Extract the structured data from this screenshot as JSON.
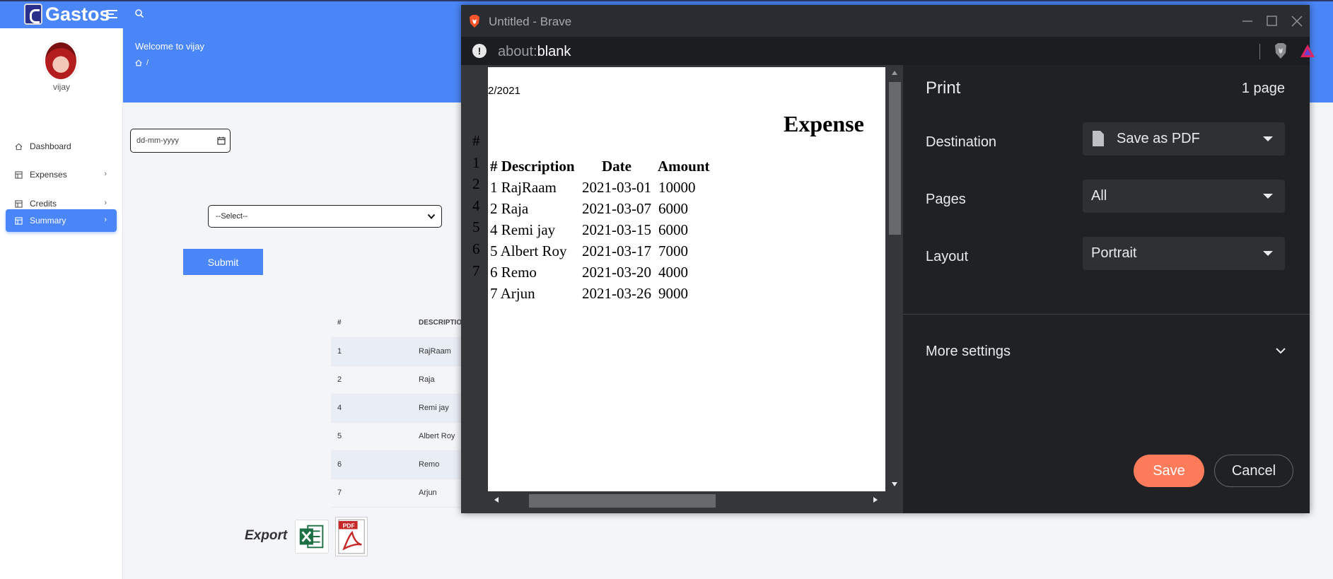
{
  "app": {
    "name": "Gastos"
  },
  "sidebar": {
    "user_name": "vijay",
    "items": [
      {
        "label": "Dashboard",
        "icon": "home-icon"
      },
      {
        "label": "Expenses",
        "icon": "table-icon"
      },
      {
        "label": "Credits",
        "icon": "table-icon"
      },
      {
        "label": "Summary",
        "icon": "table-icon",
        "active": true
      }
    ]
  },
  "header": {
    "welcome": "Welcome to vijay",
    "breadcrumb_sep": "/"
  },
  "form": {
    "date_placeholder": "dd-mm-yyyy",
    "select_value": "--Select--",
    "submit_label": "Submit"
  },
  "table": {
    "headers": [
      "#",
      "DESCRIPTION"
    ],
    "rows": [
      {
        "id": "1",
        "description": "RajRaam"
      },
      {
        "id": "2",
        "description": "Raja"
      },
      {
        "id": "4",
        "description": "Remi jay"
      },
      {
        "id": "5",
        "description": "Albert Roy"
      },
      {
        "id": "6",
        "description": "Remo"
      },
      {
        "id": "7",
        "description": "Arjun"
      }
    ]
  },
  "export": {
    "label": "Export"
  },
  "browser": {
    "title": "Untitled - Brave",
    "url_scheme": "about:",
    "url_path": "blank",
    "preview": {
      "date_fragment": "2/2021",
      "title": "Expense",
      "underlay_head": "#",
      "underlay_rows": [
        "1",
        "2",
        "4",
        "5",
        "6",
        "7"
      ],
      "columns": [
        "# Description",
        "Date",
        "Amount"
      ],
      "rows": [
        {
          "label": "1 RajRaam",
          "date": "2021-03-01",
          "amount": "10000"
        },
        {
          "label": "2 Raja",
          "date": "2021-03-07",
          "amount": "6000"
        },
        {
          "label": "4 Remi jay",
          "date": "2021-03-15",
          "amount": "6000"
        },
        {
          "label": "5 Albert Roy",
          "date": "2021-03-17",
          "amount": "7000"
        },
        {
          "label": "6 Remo",
          "date": "2021-03-20",
          "amount": "4000"
        },
        {
          "label": "7 Arjun",
          "date": "2021-03-26",
          "amount": "9000"
        }
      ]
    },
    "print": {
      "title": "Print",
      "page_count": "1 page",
      "destination_label": "Destination",
      "destination_value": "Save as PDF",
      "pages_label": "Pages",
      "pages_value": "All",
      "layout_label": "Layout",
      "layout_value": "Portrait",
      "more_settings": "More settings",
      "save": "Save",
      "cancel": "Cancel"
    }
  },
  "colors": {
    "primary": "#4a86f7",
    "save_button": "#fb7b5a",
    "print_panel": "#202124"
  }
}
